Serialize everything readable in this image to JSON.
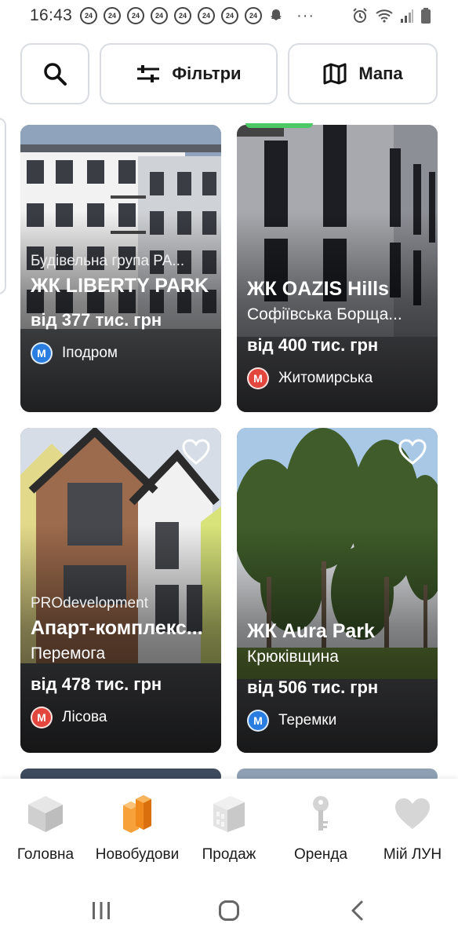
{
  "status_bar": {
    "time": "16:43",
    "badges": [
      "24",
      "24",
      "24",
      "24",
      "24",
      "24",
      "24",
      "24"
    ],
    "more": "···"
  },
  "top_actions": {
    "filters_label": "Фільтри",
    "map_label": "Мапа"
  },
  "listings": [
    {
      "developer": "Будівельна група РА...",
      "name": "ЖК LIBERTY PARK",
      "district": "",
      "price": "від 377 тис. грн",
      "metro": "Іподром",
      "metro_letter": "М",
      "metro_color": "#2a7de1"
    },
    {
      "developer": "",
      "name": "ЖК OAZIS Hills",
      "district": "Софіївська Борща...",
      "price": "від 400 тис. грн",
      "metro": "Житомирська",
      "metro_letter": "М",
      "metro_color": "#e2463c"
    },
    {
      "developer": "PROdevelopment",
      "name": "Апарт-комплекс...",
      "district": "Перемога",
      "price": "від 478 тис. грн",
      "metro": "Лісова",
      "metro_letter": "М",
      "metro_color": "#e2463c"
    },
    {
      "developer": "",
      "name": "ЖК Aura Park",
      "district": "Крюківщина",
      "price": "від 506 тис. грн",
      "metro": "Теремки",
      "metro_letter": "М",
      "metro_color": "#2a7de1"
    }
  ],
  "bottom_nav": {
    "items": [
      {
        "label": "Головна",
        "icon": "cube-icon"
      },
      {
        "label": "Новобудови",
        "icon": "buildings-icon",
        "active": true
      },
      {
        "label": "Продаж",
        "icon": "apartment-block-icon"
      },
      {
        "label": "Оренда",
        "icon": "key-icon"
      },
      {
        "label": "Мій ЛУН",
        "icon": "heart-icon"
      }
    ]
  },
  "colors": {
    "accent": "#f08a1c",
    "metro_blue": "#2a7de1",
    "metro_red": "#e2463c",
    "border": "#d9dce1"
  }
}
